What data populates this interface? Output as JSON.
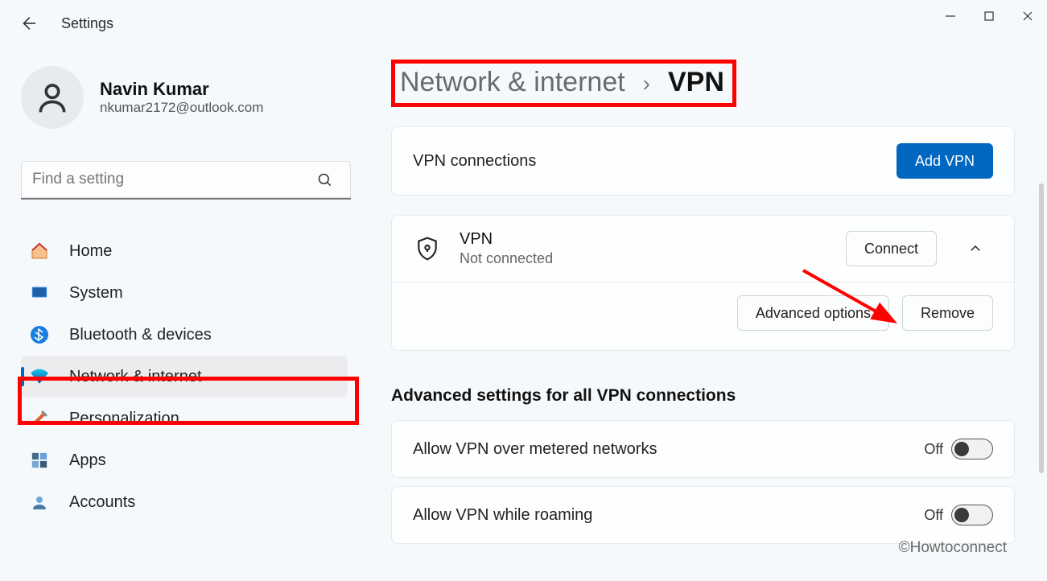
{
  "window": {
    "app_title": "Settings"
  },
  "user": {
    "name": "Navin Kumar",
    "email": "nkumar2172@outlook.com"
  },
  "search": {
    "placeholder": "Find a setting"
  },
  "sidebar": {
    "items": [
      {
        "label": "Home"
      },
      {
        "label": "System"
      },
      {
        "label": "Bluetooth & devices"
      },
      {
        "label": "Network & internet"
      },
      {
        "label": "Personalization"
      },
      {
        "label": "Apps"
      },
      {
        "label": "Accounts"
      }
    ]
  },
  "breadcrumb": {
    "parent": "Network & internet",
    "current": "VPN"
  },
  "vpn_section": {
    "header": "VPN connections",
    "add_button": "Add VPN",
    "conn": {
      "name": "VPN",
      "status": "Not connected",
      "connect_btn": "Connect",
      "advanced_btn": "Advanced options",
      "remove_btn": "Remove"
    }
  },
  "advanced": {
    "heading": "Advanced settings for all VPN connections",
    "row1": {
      "label": "Allow VPN over metered networks",
      "state": "Off"
    },
    "row2": {
      "label": "Allow VPN while roaming",
      "state": "Off"
    }
  },
  "watermark": "©Howtoconnect",
  "colors": {
    "accent": "#0067c0",
    "highlight": "#ff0000"
  }
}
